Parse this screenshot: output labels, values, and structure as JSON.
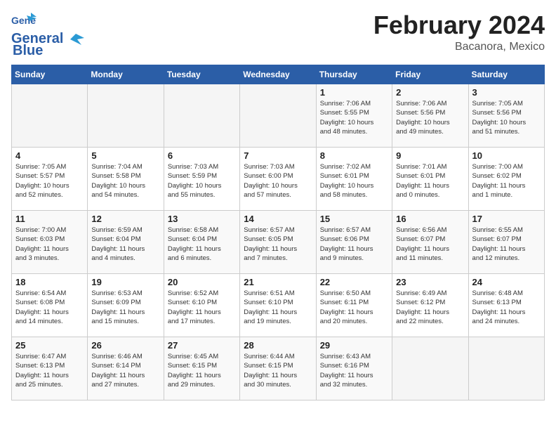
{
  "header": {
    "logo_line1": "General",
    "logo_line2": "Blue",
    "month_title": "February 2024",
    "location": "Bacanora, Mexico"
  },
  "weekdays": [
    "Sunday",
    "Monday",
    "Tuesday",
    "Wednesday",
    "Thursday",
    "Friday",
    "Saturday"
  ],
  "weeks": [
    [
      {
        "day": "",
        "info": ""
      },
      {
        "day": "",
        "info": ""
      },
      {
        "day": "",
        "info": ""
      },
      {
        "day": "",
        "info": ""
      },
      {
        "day": "1",
        "info": "Sunrise: 7:06 AM\nSunset: 5:55 PM\nDaylight: 10 hours\nand 48 minutes."
      },
      {
        "day": "2",
        "info": "Sunrise: 7:06 AM\nSunset: 5:56 PM\nDaylight: 10 hours\nand 49 minutes."
      },
      {
        "day": "3",
        "info": "Sunrise: 7:05 AM\nSunset: 5:56 PM\nDaylight: 10 hours\nand 51 minutes."
      }
    ],
    [
      {
        "day": "4",
        "info": "Sunrise: 7:05 AM\nSunset: 5:57 PM\nDaylight: 10 hours\nand 52 minutes."
      },
      {
        "day": "5",
        "info": "Sunrise: 7:04 AM\nSunset: 5:58 PM\nDaylight: 10 hours\nand 54 minutes."
      },
      {
        "day": "6",
        "info": "Sunrise: 7:03 AM\nSunset: 5:59 PM\nDaylight: 10 hours\nand 55 minutes."
      },
      {
        "day": "7",
        "info": "Sunrise: 7:03 AM\nSunset: 6:00 PM\nDaylight: 10 hours\nand 57 minutes."
      },
      {
        "day": "8",
        "info": "Sunrise: 7:02 AM\nSunset: 6:01 PM\nDaylight: 10 hours\nand 58 minutes."
      },
      {
        "day": "9",
        "info": "Sunrise: 7:01 AM\nSunset: 6:01 PM\nDaylight: 11 hours\nand 0 minutes."
      },
      {
        "day": "10",
        "info": "Sunrise: 7:00 AM\nSunset: 6:02 PM\nDaylight: 11 hours\nand 1 minute."
      }
    ],
    [
      {
        "day": "11",
        "info": "Sunrise: 7:00 AM\nSunset: 6:03 PM\nDaylight: 11 hours\nand 3 minutes."
      },
      {
        "day": "12",
        "info": "Sunrise: 6:59 AM\nSunset: 6:04 PM\nDaylight: 11 hours\nand 4 minutes."
      },
      {
        "day": "13",
        "info": "Sunrise: 6:58 AM\nSunset: 6:04 PM\nDaylight: 11 hours\nand 6 minutes."
      },
      {
        "day": "14",
        "info": "Sunrise: 6:57 AM\nSunset: 6:05 PM\nDaylight: 11 hours\nand 7 minutes."
      },
      {
        "day": "15",
        "info": "Sunrise: 6:57 AM\nSunset: 6:06 PM\nDaylight: 11 hours\nand 9 minutes."
      },
      {
        "day": "16",
        "info": "Sunrise: 6:56 AM\nSunset: 6:07 PM\nDaylight: 11 hours\nand 11 minutes."
      },
      {
        "day": "17",
        "info": "Sunrise: 6:55 AM\nSunset: 6:07 PM\nDaylight: 11 hours\nand 12 minutes."
      }
    ],
    [
      {
        "day": "18",
        "info": "Sunrise: 6:54 AM\nSunset: 6:08 PM\nDaylight: 11 hours\nand 14 minutes."
      },
      {
        "day": "19",
        "info": "Sunrise: 6:53 AM\nSunset: 6:09 PM\nDaylight: 11 hours\nand 15 minutes."
      },
      {
        "day": "20",
        "info": "Sunrise: 6:52 AM\nSunset: 6:10 PM\nDaylight: 11 hours\nand 17 minutes."
      },
      {
        "day": "21",
        "info": "Sunrise: 6:51 AM\nSunset: 6:10 PM\nDaylight: 11 hours\nand 19 minutes."
      },
      {
        "day": "22",
        "info": "Sunrise: 6:50 AM\nSunset: 6:11 PM\nDaylight: 11 hours\nand 20 minutes."
      },
      {
        "day": "23",
        "info": "Sunrise: 6:49 AM\nSunset: 6:12 PM\nDaylight: 11 hours\nand 22 minutes."
      },
      {
        "day": "24",
        "info": "Sunrise: 6:48 AM\nSunset: 6:13 PM\nDaylight: 11 hours\nand 24 minutes."
      }
    ],
    [
      {
        "day": "25",
        "info": "Sunrise: 6:47 AM\nSunset: 6:13 PM\nDaylight: 11 hours\nand 25 minutes."
      },
      {
        "day": "26",
        "info": "Sunrise: 6:46 AM\nSunset: 6:14 PM\nDaylight: 11 hours\nand 27 minutes."
      },
      {
        "day": "27",
        "info": "Sunrise: 6:45 AM\nSunset: 6:15 PM\nDaylight: 11 hours\nand 29 minutes."
      },
      {
        "day": "28",
        "info": "Sunrise: 6:44 AM\nSunset: 6:15 PM\nDaylight: 11 hours\nand 30 minutes."
      },
      {
        "day": "29",
        "info": "Sunrise: 6:43 AM\nSunset: 6:16 PM\nDaylight: 11 hours\nand 32 minutes."
      },
      {
        "day": "",
        "info": ""
      },
      {
        "day": "",
        "info": ""
      }
    ]
  ]
}
